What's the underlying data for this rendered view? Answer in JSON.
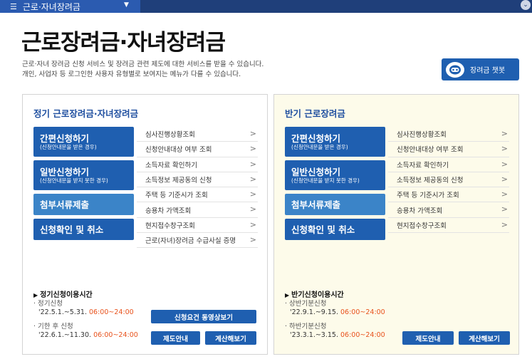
{
  "nav": {
    "menu_label": "근로·자녀장려금",
    "menu_icon": "hamburger-icon",
    "caret": "▼"
  },
  "page": {
    "title": "근로장려금·자녀장려금",
    "desc_line1": "근로·자녀 장려금 신청 서비스 및 장려금 관련 제도에 대한 서비스를 받을 수 있습니다.",
    "desc_line2": "개인, 사업자 등 로그인한 사용자 유형별로 보여지는 메뉴가 다를 수 있습니다."
  },
  "chatbot": {
    "label": "장려금 챗봇",
    "icon": "chatbot-icon"
  },
  "regular": {
    "title": "정기 근로장려금·자녀장려금",
    "easy_apply": {
      "label": "간편신청하기",
      "sub": "(신청안내문을 받은 경우)"
    },
    "general_apply": {
      "label": "일반신청하기",
      "sub": "(신청안내문을 받지 못한 경우)"
    },
    "attach": "첨부서류제출",
    "confirm_cancel": "신청확인 및 취소",
    "links": [
      "심사진행상황조회",
      "신청안내대상 여부 조회",
      "소득자료 확인하기",
      "소득정보 제공동의 신청",
      "주택 등 기준시가 조회",
      "승용차 가액조회",
      "현지접수창구조회",
      "근로(자녀)장려금 수급사실 증명"
    ],
    "schedule_title": "정기신청이용시간",
    "schedule": [
      {
        "label": "정기신청",
        "period": "'22.5.1.~5.31.",
        "time": "06:00~24:00"
      },
      {
        "label": "기한 후 신청",
        "period": "'22.6.1.~11.30.",
        "time": "06:00~24:00"
      }
    ],
    "video_button": "신청요건 동영상보기",
    "guide_button": "제도안내",
    "calc_button": "계산해보기"
  },
  "half": {
    "title": "반기 근로장려금",
    "easy_apply": {
      "label": "간편신청하기",
      "sub": "(신청안내문을 받은 경우)"
    },
    "general_apply": {
      "label": "일반신청하기",
      "sub": "(신청안내문을 받지 못한 경우)"
    },
    "attach": "첨부서류제출",
    "confirm_cancel": "신청확인 및 취소",
    "links": [
      "심사진행상황조회",
      "신청안내대상 여부 조회",
      "소득자료 확인하기",
      "소득정보 제공동의 신청",
      "주택 등 기준시가 조회",
      "승용차 가액조회",
      "현지접수창구조회"
    ],
    "schedule_title": "반기신청이용시간",
    "schedule": [
      {
        "label": "상반기분신청",
        "period": "'22.9.1.~9.15.",
        "time": "06:00~24:00"
      },
      {
        "label": "하반기분신청",
        "period": "'23.3.1.~3.15.",
        "time": "06:00~24:00"
      }
    ],
    "guide_button": "제도안내",
    "calc_button": "계산해보기"
  },
  "colors": {
    "primary": "#1f5fb0",
    "secondary": "#3b84c8",
    "highlight": "#e8521c",
    "half_bg": "#fdfbea"
  }
}
